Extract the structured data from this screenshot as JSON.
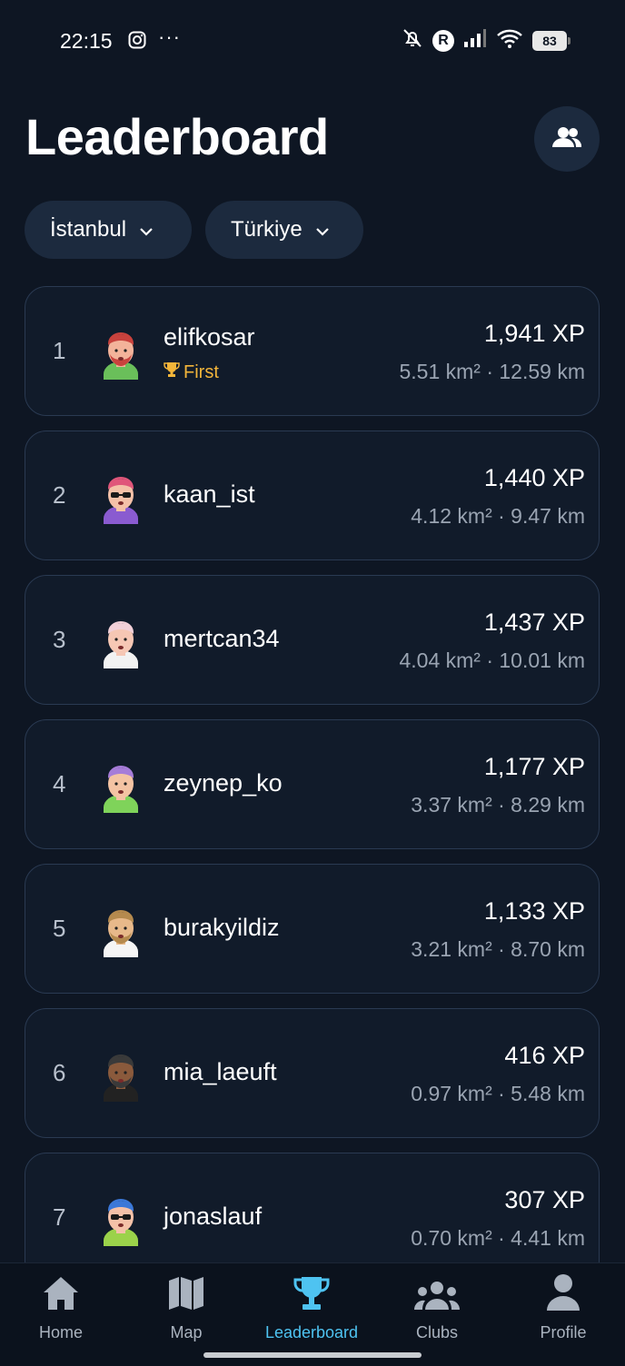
{
  "status": {
    "time": "22:15",
    "dots": "···",
    "r_badge": "R",
    "battery": "83"
  },
  "header": {
    "title": "Leaderboard"
  },
  "filters": [
    {
      "label": "İstanbul"
    },
    {
      "label": "Türkiye"
    }
  ],
  "rows": [
    {
      "rank": "1",
      "name": "elifkosar",
      "badge": "First",
      "xp": "1,941 XP",
      "dist": "5.51 km² · 12.59 km",
      "skin": "#f3b39a",
      "hair": "#c9423d",
      "shirt": "#6abf5a",
      "beard": true,
      "glasses": false
    },
    {
      "rank": "2",
      "name": "kaan_ist",
      "xp": "1,440 XP",
      "dist": "4.12 km² · 9.47 km",
      "skin": "#f4c1a8",
      "hair": "#e0567a",
      "shirt": "#8a5bd0",
      "beard": false,
      "glasses": true
    },
    {
      "rank": "3",
      "name": "mertcan34",
      "xp": "1,437 XP",
      "dist": "4.04 km² · 10.01 km",
      "skin": "#f6c7b4",
      "hair": "#f2d0d8",
      "shirt": "#f2f2f2",
      "beard": false,
      "glasses": false
    },
    {
      "rank": "4",
      "name": "zeynep_ko",
      "xp": "1,177 XP",
      "dist": "3.37 km² · 8.29 km",
      "skin": "#f4c3a3",
      "hair": "#a67cd8",
      "shirt": "#7fd35a",
      "beard": false,
      "glasses": false
    },
    {
      "rank": "5",
      "name": "burakyildiz",
      "xp": "1,133 XP",
      "dist": "3.21 km² · 8.70 km",
      "skin": "#e8b98a",
      "hair": "#b58a4e",
      "shirt": "#f5f5f5",
      "beard": true,
      "glasses": false
    },
    {
      "rank": "6",
      "name": "mia_laeuft",
      "xp": "416 XP",
      "dist": "0.97 km² · 5.48 km",
      "skin": "#8a5a3c",
      "hair": "#3a3a3a",
      "shirt": "#222222",
      "beard": true,
      "glasses": false
    },
    {
      "rank": "7",
      "name": "jonaslauf",
      "xp": "307 XP",
      "dist": "0.70 km² · 4.41 km",
      "skin": "#f4c1a8",
      "hair": "#3b78d8",
      "shirt": "#9bd24a",
      "beard": false,
      "glasses": true
    }
  ],
  "nav": [
    {
      "label": "Home",
      "icon": "home-icon"
    },
    {
      "label": "Map",
      "icon": "map-icon"
    },
    {
      "label": "Leaderboard",
      "icon": "trophy-icon",
      "active": true
    },
    {
      "label": "Clubs",
      "icon": "group-icon"
    },
    {
      "label": "Profile",
      "icon": "person-icon"
    }
  ],
  "colors": {
    "background": "#0e1623",
    "card": "#111b2a",
    "chip": "#1c2a3e",
    "accent": "#4ec3f1",
    "badge": "#f3b53a"
  }
}
